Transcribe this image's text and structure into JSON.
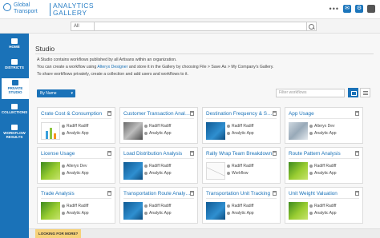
{
  "header": {
    "logo_line1": "Global",
    "logo_line2": "Transport",
    "app_title_line1": "ANALYTICS",
    "app_title_line2": "GALLERY",
    "icons": [
      "more-icon",
      "notifications-icon",
      "settings-icon",
      "user-icon"
    ],
    "more_glyph": "•••",
    "user_glyph": "✉",
    "settings_glyph": "⚙",
    "account_glyph": "👤"
  },
  "search": {
    "scope_value": "All",
    "placeholder": ""
  },
  "sidebar": {
    "items": [
      {
        "label": "HOME"
      },
      {
        "label": "DISTRICTS"
      },
      {
        "label": "PRIVATE STUDIO"
      },
      {
        "label": "COLLECTIONS"
      },
      {
        "label": "WORKFLOW RESULTS"
      }
    ]
  },
  "main": {
    "title": "Studio",
    "desc1": "A Studio contains workflows published by all Artisans within an organization.",
    "desc2_pre": "You can create a workflow using ",
    "desc2_link": "Alteryx Designer",
    "desc2_post": " and store it in the Gallery by choosing File > Save As > My Company's Gallery.",
    "desc3": "To share workflows privately, create a collection and add users and workflows to it.",
    "sort_label": "By Name",
    "filter_placeholder": "Filter workflows"
  },
  "cards": [
    {
      "title": "Crate Cost & Consumption",
      "owner": "Radiff Radiff",
      "app": "Analytic App",
      "thumb": "chart"
    },
    {
      "title": "Customer Transaction Analysis",
      "owner": "Radiff Radiff",
      "app": "Analytic App",
      "thumb": "photo"
    },
    {
      "title": "Destination Frequency & Summ...",
      "owner": "Radiff Radiff",
      "app": "Analytic App",
      "thumb": "blue"
    },
    {
      "title": "App Usage",
      "owner": "Alteryx Dev",
      "app": "Analytic App",
      "thumb": "map"
    },
    {
      "title": "License Usage",
      "owner": "Alteryx Dev",
      "app": "Analytic App",
      "thumb": "green"
    },
    {
      "title": "Load Distribution Analysis",
      "owner": "Radiff Radiff",
      "app": "Analytic App",
      "thumb": "blue"
    },
    {
      "title": "Rally Wrap Team Breakdown",
      "owner": "Radiff Radiff",
      "app": "Workflow",
      "thumb": "white"
    },
    {
      "title": "Route Pattern Analysis",
      "owner": "Radiff Radiff",
      "app": "Analytic App",
      "thumb": "green"
    },
    {
      "title": "Trade Analysis",
      "owner": "Radiff Radiff",
      "app": "Analytic App",
      "thumb": "green"
    },
    {
      "title": "Transportation Route Analysis",
      "owner": "Radiff Radiff",
      "app": "Analytic App",
      "thumb": "blue"
    },
    {
      "title": "Transportation Unit Tracking",
      "owner": "Radiff Radiff",
      "app": "Analytic App",
      "thumb": "blue"
    },
    {
      "title": "Unit Weight Valuation",
      "owner": "Radiff Radiff",
      "app": "Analytic App",
      "thumb": "green"
    }
  ],
  "footer": {
    "looking_for_more": "LOOKING FOR MORE?"
  },
  "colors": {
    "accent": "#1a72b8",
    "footer_tab": "#f6d27a"
  }
}
